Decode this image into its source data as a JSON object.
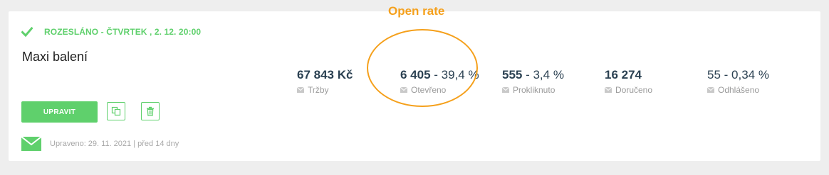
{
  "campaign": {
    "status_text": "ROZESLÁNO - ČTVRTEK , 2. 12. 20:00",
    "name": "Maxi balení",
    "edit_label": "UPRAVIT",
    "updated_text": "Upraveno: 29. 11. 2021  |  před 14 dny"
  },
  "stats": [
    {
      "value_bold": "67 843 Kč",
      "value_rest": "",
      "label": "Tržby"
    },
    {
      "value_bold": "6 405",
      "value_rest": " - 39,4 %",
      "label": "Otevřeno"
    },
    {
      "value_bold": "555",
      "value_rest": " - 3,4 %",
      "label": "Prokliknuto"
    },
    {
      "value_bold": "16 274",
      "value_rest": "",
      "label": "Doručeno"
    },
    {
      "value_bold": "",
      "value_rest": "55 - 0,34 %",
      "label": "Odhlášeno"
    }
  ],
  "annotation": {
    "label": "Open rate",
    "color": "#f5a01b"
  },
  "colors": {
    "accent_green": "#5fd06c",
    "stat_text": "#2b4152"
  },
  "icons": {
    "status": "checkmark-icon",
    "copy": "copy-icon",
    "trash": "trash-icon",
    "mail": "envelope-icon"
  }
}
